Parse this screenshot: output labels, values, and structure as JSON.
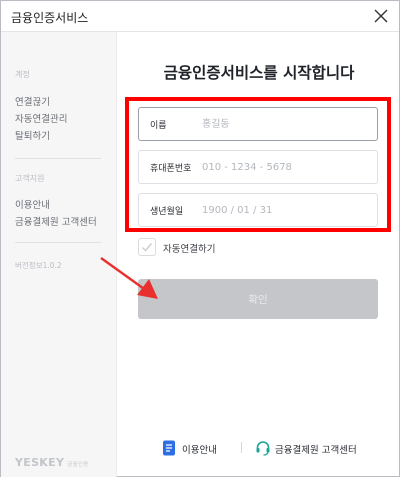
{
  "window": {
    "title": "금융인증서비스"
  },
  "sidebar": {
    "section_account": "계정",
    "items_account": [
      {
        "label": "연결끊기"
      },
      {
        "label": "자동연결관리"
      },
      {
        "label": "탈퇴하기"
      }
    ],
    "section_support": "고객지원",
    "items_support": [
      {
        "label": "이용안내"
      },
      {
        "label": "금융결제원 고객센터"
      }
    ],
    "version": "버전정보1.0.2",
    "logo": "YESKEY",
    "logo_sub": "금융인증"
  },
  "main": {
    "title": "금융인증서비스를 시작합니다",
    "fields": [
      {
        "label": "이름",
        "placeholder": "홍길동",
        "value": ""
      },
      {
        "label": "휴대폰번호",
        "placeholder": "010 - 1234 - 5678",
        "value": ""
      },
      {
        "label": "생년월일",
        "placeholder": "1900 / 01 / 31",
        "value": ""
      }
    ],
    "auto_connect_label": "자동연결하기",
    "auto_connect_checked": false,
    "confirm_label": "확인"
  },
  "footer": {
    "guide_label": "이용안내",
    "support_label": "금융결제원 고객센터",
    "guide_icon": "document-icon",
    "support_icon": "headset-icon"
  },
  "colors": {
    "highlight": "#ff0000",
    "arrow": "#e8312f",
    "button_disabled": "#c4c6c9",
    "accent_blue": "#2f6fe4",
    "accent_teal": "#1aa596"
  }
}
